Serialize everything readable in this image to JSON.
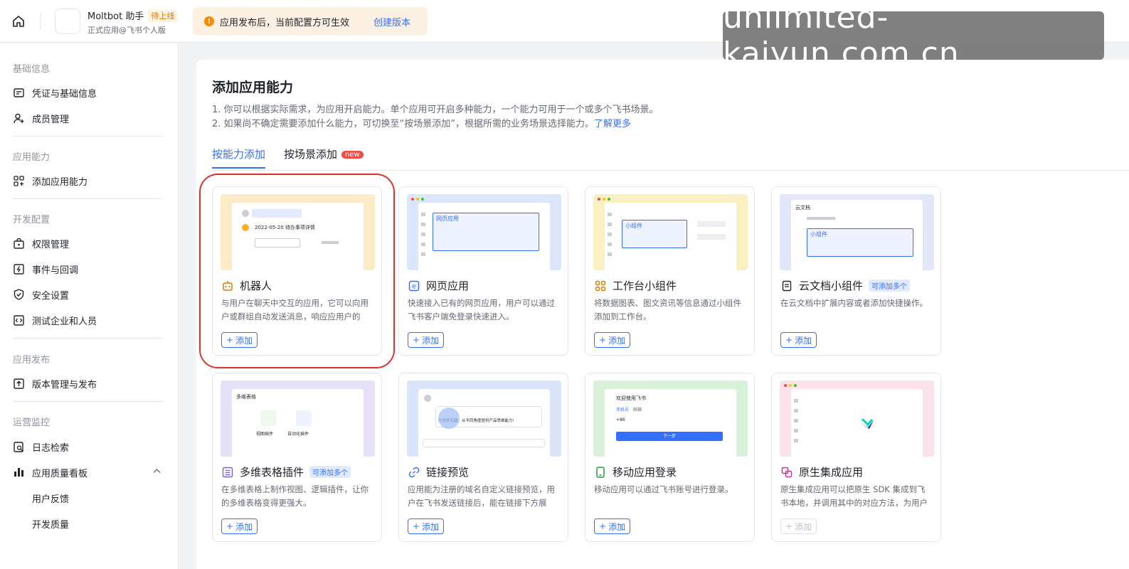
{
  "header": {
    "app_name": "Moltbot 助手",
    "status_badge": "待上线",
    "app_subtitle": "正式应用@飞书个人版",
    "notice_text": "应用发布后，当前配置方可生效",
    "notice_link": "创建版本",
    "watermark": "unlimited-kaiyun.com.cn"
  },
  "sidebar": {
    "sections": [
      {
        "title": "基础信息",
        "items": [
          {
            "label": "凭证与基础信息",
            "icon": "credential-icon"
          },
          {
            "label": "成员管理",
            "icon": "member-add-icon"
          }
        ]
      },
      {
        "title": "应用能力",
        "items": [
          {
            "label": "添加应用能力",
            "icon": "apps-add-icon"
          }
        ]
      },
      {
        "title": "开发配置",
        "items": [
          {
            "label": "权限管理",
            "icon": "permission-icon"
          },
          {
            "label": "事件与回调",
            "icon": "event-icon"
          },
          {
            "label": "安全设置",
            "icon": "shield-icon"
          },
          {
            "label": "测试企业和人员",
            "icon": "code-icon"
          }
        ]
      },
      {
        "title": "应用发布",
        "items": [
          {
            "label": "版本管理与发布",
            "icon": "upload-icon"
          }
        ]
      },
      {
        "title": "运营监控",
        "items": [
          {
            "label": "日志检索",
            "icon": "log-search-icon"
          },
          {
            "label": "应用质量看板",
            "icon": "bar-chart-icon"
          },
          {
            "label": "用户反馈"
          },
          {
            "label": "开发质量"
          }
        ]
      }
    ]
  },
  "main": {
    "title": "添加应用能力",
    "desc_1": "1. 你可以根据实际需求，为应用开启能力。单个应用可开启多种能力，一个能力可用于一个或多个飞书场景。",
    "desc_2": "2. 如果尚不确定需要添加什么能力，可切换至“按场景添加”，根据所需的业务场景选择能力。",
    "desc_link": "了解更多",
    "tabs": [
      {
        "label": "按能力添加"
      },
      {
        "label": "按场景添加",
        "badge": "new"
      }
    ],
    "add_label": "添加",
    "cards": [
      {
        "title": "机器人",
        "desc": "与用户在聊天中交互的应用，它可以向用户或群组自动发送消息，响应应用户的消...",
        "icon": "robot-icon",
        "thumb_color": "#fdebc8",
        "thumb_text": "2022-05-20 待办事项详情"
      },
      {
        "title": "网页应用",
        "desc": "快速接入已有的网页应用，用户可以通过飞书客户端免登录快速进入。",
        "icon": "web-e-icon",
        "thumb_color": "#dce6fb",
        "thumb_text": "网页应用"
      },
      {
        "title": "工作台小组件",
        "desc": "将数据图表、图文资讯等信息通过小组件添加到工作台。",
        "icon": "widget-icon",
        "thumb_color": "#fbf0c4",
        "thumb_text": "小组件"
      },
      {
        "title": "云文档小组件",
        "badge": "可添加多个",
        "desc": "在云文档中扩展内容或者添加快捷操作。",
        "icon": "doc-icon",
        "thumb_color": "#e1e6f8",
        "thumb_text": "小组件",
        "thumb_header": "云文档"
      },
      {
        "title": "多维表格插件",
        "badge": "可添加多个",
        "desc": "在多维表格上制作视图、逻辑插件，让你的多维表格变得更强大。",
        "icon": "table-icon",
        "thumb_color": "#e6e1f8",
        "thumb_header": "多维表格",
        "thumb_items": [
          "视图插件",
          "自动化插件"
        ]
      },
      {
        "title": "链接预览",
        "desc": "应用能为注册的域名自定义链接预览，用户在飞书发送链接后，能在链接下方展示...",
        "icon": "link-icon",
        "thumb_color": "#dbe5fa",
        "thumb_text": "方说到实践，从不同角度提供产品思维能力!"
      },
      {
        "title": "移动应用登录",
        "desc": "移动应用可以通过飞书账号进行登录。",
        "icon": "mobile-icon",
        "thumb_color": "#d8f1d8",
        "thumb_header": "欢迎使用飞书",
        "thumb_tabs": [
          "手机号",
          "邮箱"
        ],
        "thumb_button": "下一步",
        "thumb_code": "+86"
      },
      {
        "title": "原生集成应用",
        "desc": "原生集成应用可以把原生 SDK 集成到飞书本地，并调用其中的对应方法，为用户提...",
        "icon": "native-icon",
        "thumb_color": "#fbe1e8",
        "disabled": true
      }
    ]
  }
}
